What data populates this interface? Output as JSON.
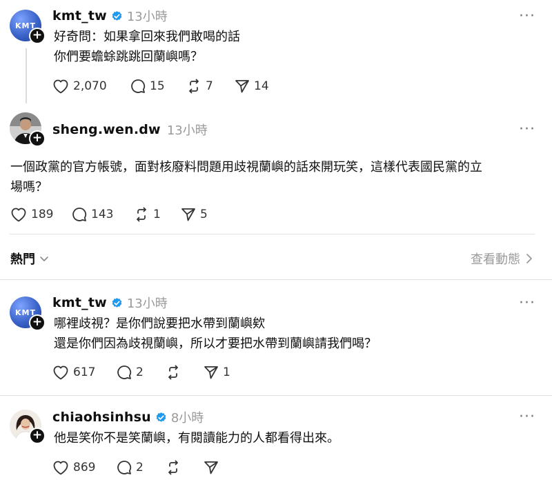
{
  "posts": [
    {
      "username": "kmt_tw",
      "time": "13小時",
      "lines": [
        "好奇問：如果拿回來我們敢喝的話",
        "你們要蟾蜍跳跳回蘭嶼嗎？"
      ],
      "likes": "2,070",
      "replies": "15",
      "reposts": "7",
      "shares": "14"
    },
    {
      "username": "sheng.wen.dw",
      "time": "13小時",
      "lines": [
        "一個政黨的官方帳號，面對核廢料問題用歧視蘭嶼的話來開玩笑，這樣代表國民黨的立",
        "場嗎？"
      ],
      "likes": "189",
      "replies": "143",
      "reposts": "1",
      "shares": "5"
    },
    {
      "username": "kmt_tw",
      "time": "13小時",
      "lines": [
        "哪裡歧視？是你們說要把水帶到蘭嶼欸",
        "還是你們因為歧視蘭嶼，所以才要把水帶到蘭嶼請我們喝？"
      ],
      "likes": "617",
      "replies": "2",
      "reposts": "",
      "shares": "1"
    },
    {
      "username": "chiaohsinhsu",
      "time": "8小時",
      "lines": [
        "他是笑你不是笑蘭嶼，有閱讀能力的人都看得出來。"
      ],
      "likes": "869",
      "replies": "2",
      "reposts": "",
      "shares": ""
    }
  ],
  "section": {
    "title": "熱門",
    "view_activity": "查看動態"
  },
  "avatar_texts": {
    "kmt": "KMT"
  },
  "more_label": "···",
  "colors": {
    "verified": "#1d9bf0",
    "kmt_avatar": "#3a63c9",
    "muted": "#9a9a9a"
  }
}
